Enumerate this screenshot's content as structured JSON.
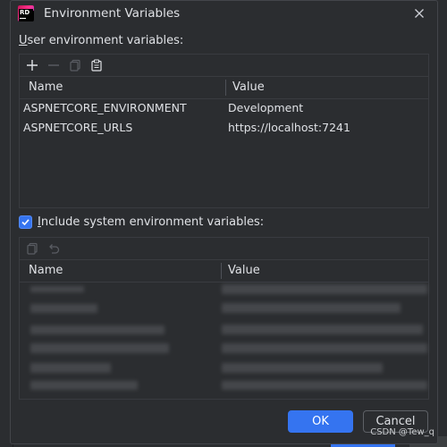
{
  "dialog": {
    "title": "Environment Variables",
    "app_logo_text": "RD"
  },
  "user_env": {
    "label_prefix": "U",
    "label_rest": "ser environment variables:",
    "toolbar_icons": [
      "add-icon",
      "remove-icon",
      "copy-icon",
      "paste-icon"
    ],
    "columns": [
      "Name",
      "Value"
    ],
    "rows": [
      {
        "name": "ASPNETCORE_ENVIRONMENT",
        "value": "Development"
      },
      {
        "name": "ASPNETCORE_URLS",
        "value": "https://localhost:7241"
      }
    ]
  },
  "system_env": {
    "checkbox_checked": true,
    "label_prefix": "I",
    "label_rest": "nclude system environment variables:",
    "toolbar_icons": [
      "copy-icon",
      "undo-icon"
    ],
    "columns": [
      "Name",
      "Value"
    ]
  },
  "buttons": {
    "ok": "OK",
    "cancel": "Cancel"
  },
  "watermark": "CSDN @Tew_q",
  "colors": {
    "accent": "#3574f0",
    "background": "#2b2d30",
    "border": "#393b40"
  }
}
